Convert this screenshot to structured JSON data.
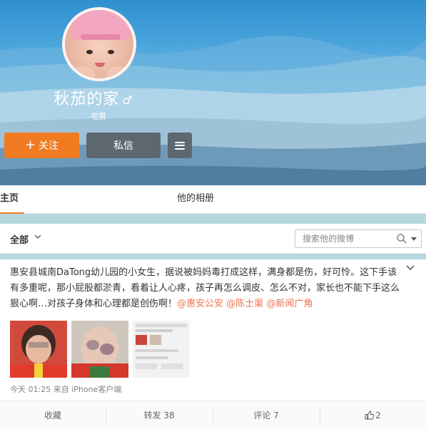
{
  "profile": {
    "name": "秋茄的家",
    "gender_icon": "male-icon",
    "gender_glyph": "♂",
    "subtitle": "宅男"
  },
  "actions_bar": {
    "follow_label": "关注",
    "follow_color": "#f07b22",
    "message_label": "私信",
    "more_icon": "menu-icon"
  },
  "tabs": [
    {
      "label": "主页",
      "active": true
    },
    {
      "label": "他的相册",
      "active": false
    }
  ],
  "filter": {
    "all_label": "全部",
    "search_placeholder": "搜索他的微博"
  },
  "post": {
    "text": "惠安县城南DaTong幼儿园的小女生，据说被妈妈毒打成这样，满身都是伤，好可怜。这下手该有多重呢，那小屁股都淤青，看着让人心疼，孩子再怎么调皮、怎么不对，家长也不能下手这么狠心啊…对孩子身体和心理都是创伤啊！",
    "mentions": [
      "@惠安公安",
      "@陈士渠",
      "@新闻广角"
    ],
    "meta": "今天 01:25 来自 iPhone客户端",
    "images": [
      "child-face-photo",
      "bruised-back-photo",
      "chat-screenshot-photo"
    ],
    "mention_color": "#eb7350"
  },
  "post_actions": {
    "collect": "收藏",
    "forward": "转发 38",
    "comment": "评论 7",
    "like_count": "2"
  }
}
